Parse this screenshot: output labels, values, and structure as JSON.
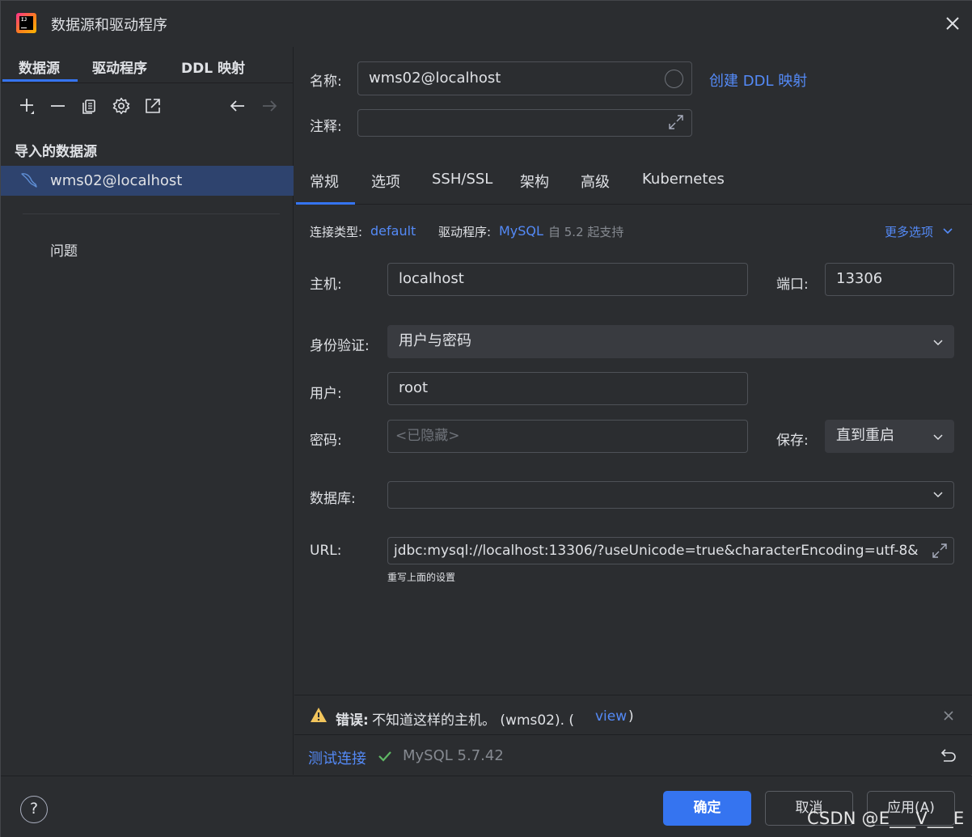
{
  "window": {
    "title": "数据源和驱动程序",
    "logo_text": "IJ"
  },
  "left": {
    "tabs": [
      "数据源",
      "驱动程序",
      "DDL 映射"
    ],
    "section_label": "导入的数据源",
    "datasource_item": "wms02@localhost",
    "problems_label": "问题"
  },
  "form": {
    "name_label": "名称:",
    "name_value": "wms02@localhost",
    "create_ddl_link": "创建 DDL 映射",
    "comment_label": "注释:",
    "comment_value": "",
    "tabs": [
      "常规",
      "选项",
      "SSH/SSL",
      "架构",
      "高级",
      "Kubernetes"
    ],
    "conn_type_label": "连接类型:",
    "conn_type_value": "default",
    "driver_label": "驱动程序:",
    "driver_value": "MySQL",
    "driver_note": "自 5.2 起支持",
    "more_options": "更多选项",
    "host_label": "主机:",
    "host_value": "localhost",
    "port_label": "端口:",
    "port_value": "13306",
    "auth_label": "身份验证:",
    "auth_value": "用户与密码",
    "user_label": "用户:",
    "user_value": "root",
    "password_label": "密码:",
    "password_placeholder": "<已隐藏>",
    "save_label": "保存:",
    "save_value": "直到重启",
    "database_label": "数据库:",
    "database_value": "",
    "url_label": "URL:",
    "url_value": "jdbc:mysql://localhost:13306/?useUnicode=true&characterEncoding=utf-8&",
    "url_note": "重写上面的设置"
  },
  "error": {
    "prefix": "错误:",
    "message": "不知道这样的主机。 (wms02). (",
    "link": "view",
    "suffix": ")"
  },
  "test": {
    "link": "测试连接",
    "result": "MySQL 5.7.42"
  },
  "buttons": {
    "ok": "确定",
    "cancel": "取消",
    "apply": "应用(A)",
    "help": "?"
  },
  "watermark": "CSDN @E___V___E",
  "colors": {
    "accent": "#3574f0",
    "link": "#548af7",
    "selection": "#2e436e",
    "warning": "#f2c55c",
    "success": "#5fb865"
  }
}
